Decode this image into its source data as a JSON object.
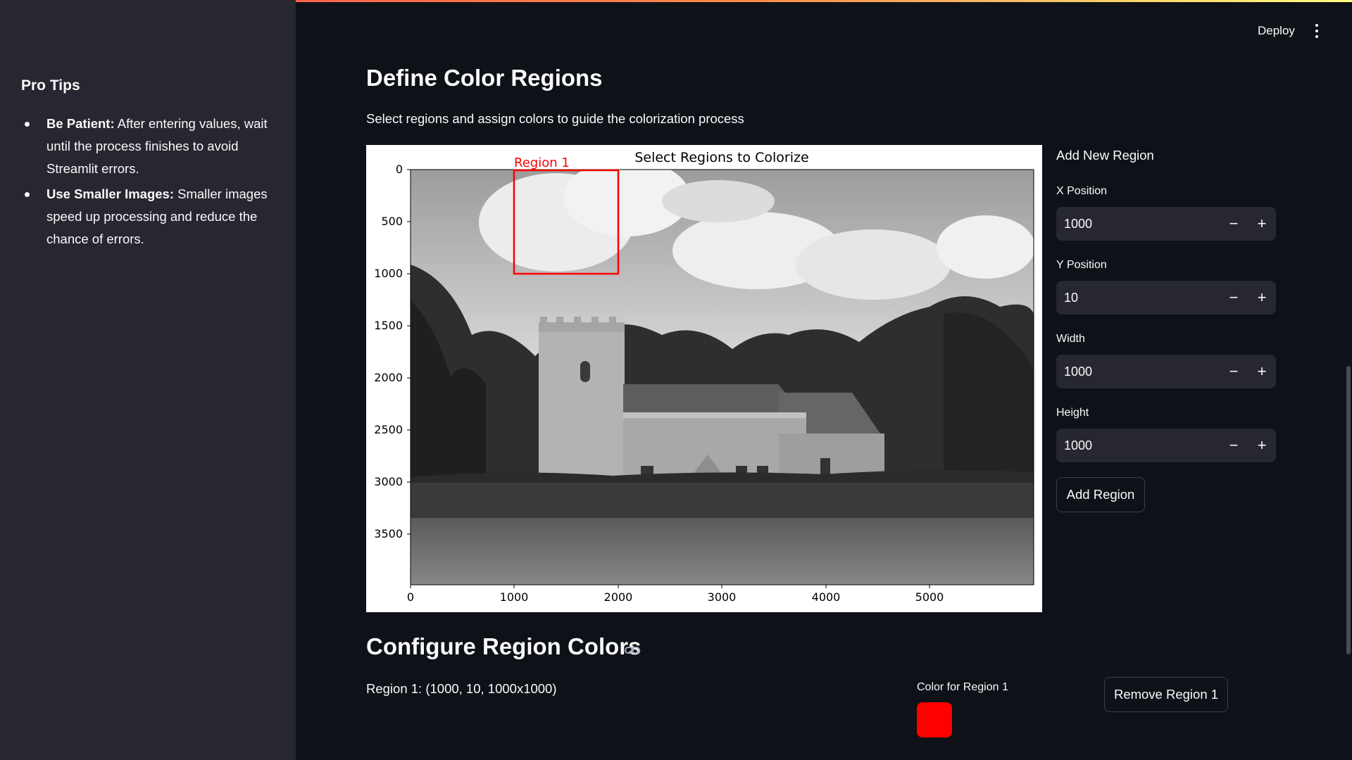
{
  "colors": {
    "accent_red": "#ff0000",
    "sidebar_bg": "#262730",
    "main_bg": "#0e1117"
  },
  "header": {
    "deploy_label": "Deploy",
    "menu_icon": "kebab-menu-icon"
  },
  "sidebar": {
    "title": "Pro Tips",
    "tips": [
      {
        "bold": "Be Patient:",
        "text": "After entering values, wait until the process finishes to avoid Streamlit errors."
      },
      {
        "bold": "Use Smaller Images:",
        "text": "Smaller images speed up processing and reduce the chance of errors."
      }
    ]
  },
  "main": {
    "title": "Define Color Regions",
    "subtitle": "Select regions and assign colors to guide the colorization process",
    "plot": {
      "title": "Select Regions to Colorize",
      "region_label": "Region 1",
      "x_ticks": [
        "0",
        "1000",
        "2000",
        "3000",
        "4000",
        "5000"
      ],
      "y_ticks": [
        "0",
        "500",
        "1000",
        "1500",
        "2000",
        "2500",
        "3000",
        "3500"
      ]
    },
    "add_region": {
      "title": "Add New Region",
      "fields": [
        {
          "label": "X Position",
          "value": "1000"
        },
        {
          "label": "Y Position",
          "value": "10"
        },
        {
          "label": "Width",
          "value": "1000"
        },
        {
          "label": "Height",
          "value": "1000"
        }
      ],
      "button_label": "Add Region"
    },
    "configure": {
      "title": "Configure Region Colors",
      "region_text": "Region 1: (1000, 10, 1000x1000)",
      "color_label": "Color for Region 1",
      "color_value": "#ff0000",
      "remove_label": "Remove Region 1"
    }
  }
}
